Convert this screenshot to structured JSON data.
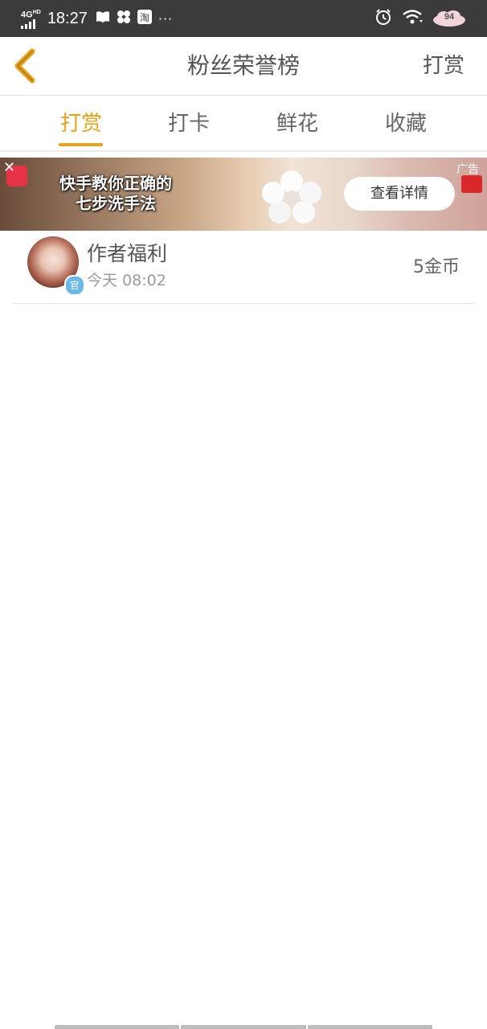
{
  "status_bar": {
    "network": "4G",
    "network_hd": "HD",
    "time": "18:27",
    "more": "···",
    "battery": "94",
    "icons": [
      "book-icon",
      "pinwheel-icon",
      "taobao-icon",
      "alarm-icon",
      "wifi-icon",
      "battery-icon"
    ]
  },
  "header": {
    "title": "粉丝荣誉榜",
    "right_action": "打赏"
  },
  "tabs": [
    {
      "label": "打赏",
      "active": true
    },
    {
      "label": "打卡",
      "active": false
    },
    {
      "label": "鲜花",
      "active": false
    },
    {
      "label": "收藏",
      "active": false
    }
  ],
  "ad": {
    "headline_line1": "快手教你正确的",
    "headline_line2": "七步洗手法",
    "cta": "查看详情",
    "tag": "广告"
  },
  "list": [
    {
      "name": "作者福利",
      "time": "今天 08:02",
      "amount": "5金币",
      "badge": "官"
    }
  ],
  "colors": {
    "accent": "#e8a31c",
    "status_bar": "#3b3b3b"
  }
}
